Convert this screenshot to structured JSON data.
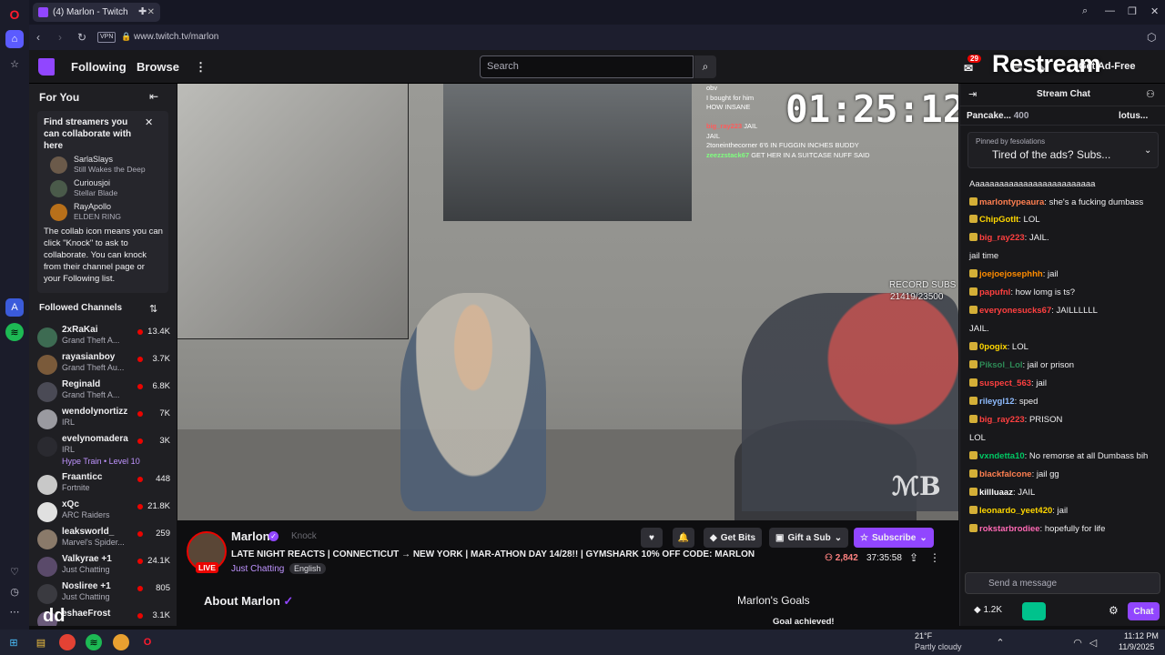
{
  "browser": {
    "tab_title": "(4) Marlon - Twitch",
    "url": "www.twitch.tv/marlon",
    "vpn_label": "VPN"
  },
  "nav": {
    "following": "Following",
    "browse": "Browse",
    "search_placeholder": "Search",
    "notif_count": "29",
    "ad_free": "Get Ad-Free",
    "restream_overlay": "Restream"
  },
  "sidebar": {
    "for_you": "For You",
    "collab_title": "Find streamers you can collaborate with here",
    "suggestions": [
      {
        "name": "SarlaSlays",
        "game": "Still Wakes the Deep"
      },
      {
        "name": "Curiousjoi",
        "game": "Stellar Blade"
      },
      {
        "name": "RayApollo",
        "game": "ELDEN RING"
      }
    ],
    "collab_body": "The collab icon means you can click \"Knock\" to ask to collaborate. You can knock from their channel page or your Following list.",
    "followed_title": "Followed Channels",
    "channels": [
      {
        "name": "2xRaKai",
        "game": "Grand Theft A...",
        "viewers": "13.4K"
      },
      {
        "name": "rayasianboy",
        "game": "Grand Theft Au...",
        "viewers": "3.7K"
      },
      {
        "name": "Reginald",
        "game": "Grand Theft A...",
        "viewers": "6.8K"
      },
      {
        "name": "wendolynortizz",
        "game": "IRL",
        "viewers": "7K"
      },
      {
        "name": "evelynomadera",
        "game": "IRL",
        "viewers": "3K",
        "extra": "Hype Train • Level 10"
      },
      {
        "name": "Fraanticc",
        "game": "Fortnite",
        "viewers": "448"
      },
      {
        "name": "xQc",
        "game": "ARC Raiders",
        "viewers": "21.8K"
      },
      {
        "name": "leaksworld_",
        "game": "Marvel's Spider...",
        "viewers": "259"
      },
      {
        "name": "Valkyrae +1",
        "game": "Just Chatting",
        "viewers": "24.1K"
      },
      {
        "name": "Nosliree +1",
        "game": "Just Chatting",
        "viewers": "805"
      },
      {
        "name": "eshaeFrost",
        "game": "",
        "viewers": "3.1K"
      }
    ]
  },
  "video": {
    "timer": "01:25:12",
    "record_line1": "RECORD SUBS",
    "record_line2": "21419/23500",
    "overlay_chat": [
      {
        "user": "",
        "text": "obv"
      },
      {
        "user": "",
        "text": "I bought for him"
      },
      {
        "user": "",
        "text": "HOW INSANE"
      },
      {
        "user": "",
        "text": ""
      },
      {
        "user": "big_ray223",
        "text": "JAIL"
      },
      {
        "user": "",
        "text": "JAIL"
      },
      {
        "user": "",
        "text": "2toneinthecorner 6'6 IN FUGGIN INCHES BUDDY"
      },
      {
        "user": "zeezzstack67",
        "text": "GET HER IN A SUITCASE NUFF SAID"
      }
    ]
  },
  "stream": {
    "name": "Marlon",
    "knock": "Knock",
    "live": "LIVE",
    "title": "LATE NIGHT REACTS | CONNECTICUT → NEW YORK | MAR-ATHON DAY 14/28!! | GYMSHARK 10% OFF CODE: MARLON",
    "category": "Just Chatting",
    "language": "English",
    "get_bits": "Get Bits",
    "gift_sub": "Gift a Sub",
    "subscribe": "Subscribe",
    "viewers": "2,842",
    "uptime": "37:35:58",
    "about": "About Marlon",
    "goals": "Marlon's Goals",
    "goal_achieved": "Goal achieved!"
  },
  "chat": {
    "title": "Stream Chat",
    "leader1": "Pancake...",
    "leader1_amount": "400",
    "leader2": "lotus...",
    "pinned_by": "Pinned by",
    "pinned_user": "fesolations",
    "pinned_msg": "Tired of the ads? Subs...",
    "messages": [
      {
        "user": "",
        "color": "#efeff1",
        "text": "Aaaaaaaaaaaaaaaaaaaaaaaaaa"
      },
      {
        "user": "marlontypeaura",
        "color": "#ff7f50",
        "text": "she's a fucking dumbass"
      },
      {
        "user": "ChipGotIt",
        "color": "#ffd700",
        "text": "LOL"
      },
      {
        "user": "big_ray223",
        "color": "#ff4040",
        "text": "JAIL."
      },
      {
        "user": "",
        "color": "#0000ff",
        "text": "jail time"
      },
      {
        "user": "joejoejosephhh",
        "color": "#ff8c00",
        "text": "jail"
      },
      {
        "user": "papufnl",
        "color": "#ff4040",
        "text": "how lomg is ts?"
      },
      {
        "user": "everyonesucks67",
        "color": "#ff4040",
        "text": "JAILLLLLL"
      },
      {
        "user": "",
        "color": "#0000ff",
        "text": "JAIL."
      },
      {
        "user": "0pogix",
        "color": "#ffd700",
        "text": "LOL"
      },
      {
        "user": "Piksol_Lol",
        "color": "#2e8b57",
        "text": "jail or prison"
      },
      {
        "user": "suspect_563",
        "color": "#ff4040",
        "text": "jail"
      },
      {
        "user": "rileygl12",
        "color": "#8fbcff",
        "text": "sped"
      },
      {
        "user": "big_ray223",
        "color": "#ff4040",
        "text": "PRISON"
      },
      {
        "user": "",
        "color": "#0000ff",
        "text": "LOL"
      },
      {
        "user": "vxndetta10",
        "color": "#00c864",
        "text": "No remorse at all Dumbass bih"
      },
      {
        "user": "blackfalcone",
        "color": "#ff7f50",
        "text": "jail gg"
      },
      {
        "user": "killluaaz",
        "color": "#ffffff",
        "text": "JAIL"
      },
      {
        "user": "leonardo_yeet420",
        "color": "#ffd700",
        "text": "jail"
      },
      {
        "user": "rokstarbrodiee",
        "color": "#ff69b4",
        "text": "hopefully for life"
      }
    ],
    "input_placeholder": "Send a message",
    "bits": "1.2K",
    "send": "Chat"
  },
  "taskbar": {
    "temp": "21°F",
    "weather": "Partly cloudy",
    "time": "11:12 PM",
    "date": "11/9/2025",
    "overlay_text": "dd"
  }
}
